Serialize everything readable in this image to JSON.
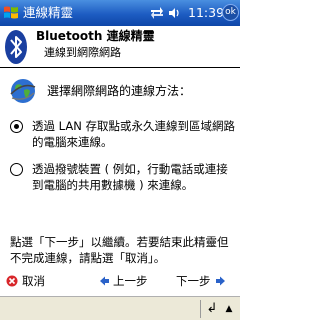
{
  "statusbar": {
    "app_title": "連線精靈",
    "time": "11:39",
    "ok_label": "ok"
  },
  "header": {
    "title": "Bluetooth 連線精靈",
    "subtitle": "連線到網際網路"
  },
  "content": {
    "prompt": "選擇網際網路的連線方法：",
    "options": [
      {
        "label": "透過 LAN 存取點或永久連線到區域網路的電腦來連線。",
        "selected": true
      },
      {
        "label": "透過撥號裝置 ( 例如，行動電話或連接到電腦的共用數據機 ) 來連線。",
        "selected": false
      }
    ],
    "instructions": "點選「下一步」以繼續。若要結束此精靈但不完成連線，請點選「取消」。"
  },
  "nav": {
    "cancel_label": "取消",
    "back_label": "上一步",
    "next_label": "下一步"
  },
  "commandbar": {
    "return_glyph": "↲",
    "sip_glyph": "▲"
  },
  "colors": {
    "titlebar": "#1d5cc2",
    "bluetooth": "#1a3fa0",
    "cancel_red": "#d8262a",
    "nav_arrow": "#2a62c9",
    "commandbar": "#ece9d8"
  },
  "icons": [
    "windows-start-icon",
    "connectivity-icon",
    "volume-icon",
    "bluetooth-icon",
    "globe-icon",
    "cancel-icon",
    "back-arrow-icon",
    "next-arrow-icon"
  ]
}
